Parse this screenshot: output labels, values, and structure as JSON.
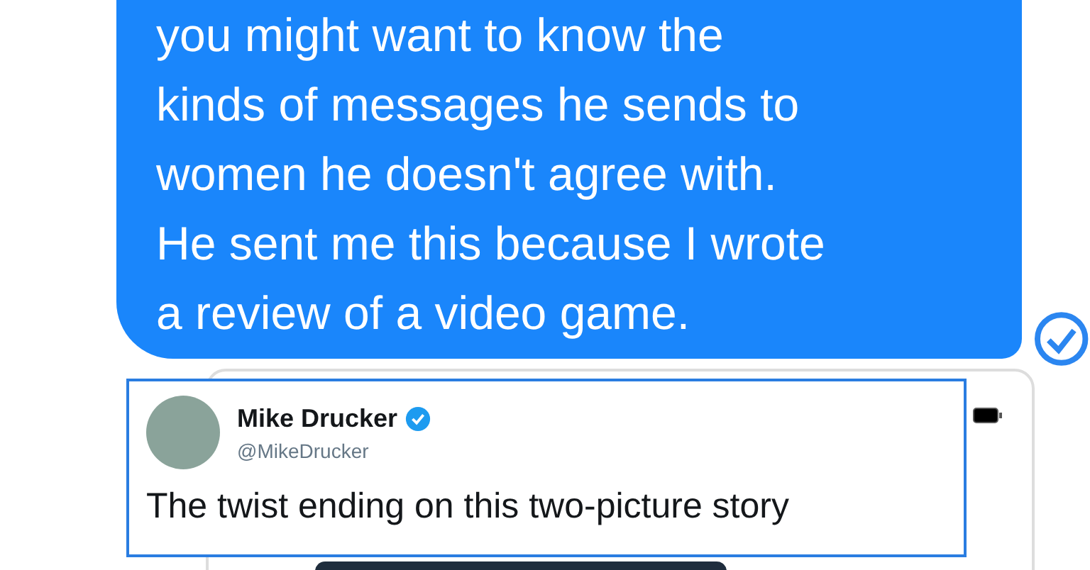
{
  "message": {
    "lines": [
      "you might want to know the",
      "kinds of messages he sends to",
      "women he doesn't agree with.",
      "He sent me this because I wrote",
      "a review of a video game."
    ]
  },
  "tweet": {
    "name": "Mike Drucker",
    "verified": true,
    "handle": "@MikeDrucker",
    "text": "The twist ending on this two-picture story"
  }
}
